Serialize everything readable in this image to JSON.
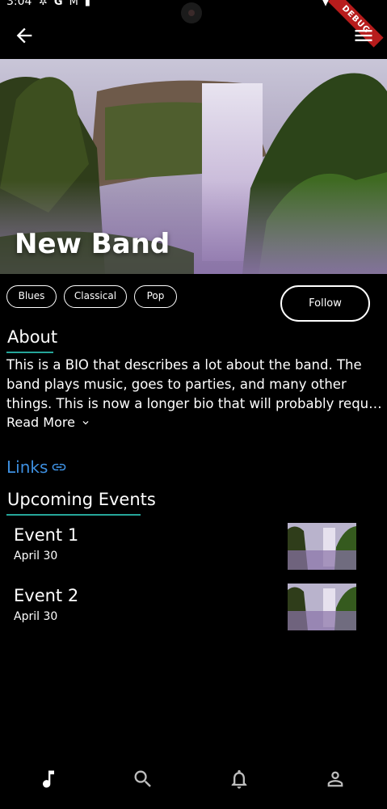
{
  "status_bar": {
    "time": "3:04",
    "left_icons": [
      "settings-icon",
      "google-icon",
      "gmail-icon",
      "sdcard-icon"
    ],
    "right_icons": [
      "wifi-icon",
      "signal-icon"
    ],
    "debug_banner": "DEBUG"
  },
  "app_bar": {
    "back_icon": "arrow-back-icon",
    "menu_icon": "hamburger-menu-icon"
  },
  "band": {
    "name": "New Band",
    "genres": [
      "Blues",
      "Classical",
      "Pop"
    ],
    "follow_label": "Follow"
  },
  "about": {
    "title": "About",
    "bio_lines": [
      "This is a BIO that describes a lot about the band. The",
      "band plays music, goes to parties, and many other",
      "things. This is now a longer bio that will probably requir..."
    ],
    "read_more_label": "Read More"
  },
  "links": {
    "label": "Links",
    "icon": "link-icon"
  },
  "events": {
    "title": "Upcoming Events",
    "items": [
      {
        "title": "Event 1",
        "date": "April 30"
      },
      {
        "title": "Event 2",
        "date": "April 30"
      }
    ]
  },
  "bottom_nav": {
    "items": [
      "music-note-icon",
      "search-icon",
      "notifications-icon",
      "profile-icon"
    ],
    "active_index": 0
  },
  "colors": {
    "background": "#000000",
    "accent_underline": "#26a69a",
    "link_blue": "#3d8fe0",
    "debug_red": "#b71c1c"
  }
}
